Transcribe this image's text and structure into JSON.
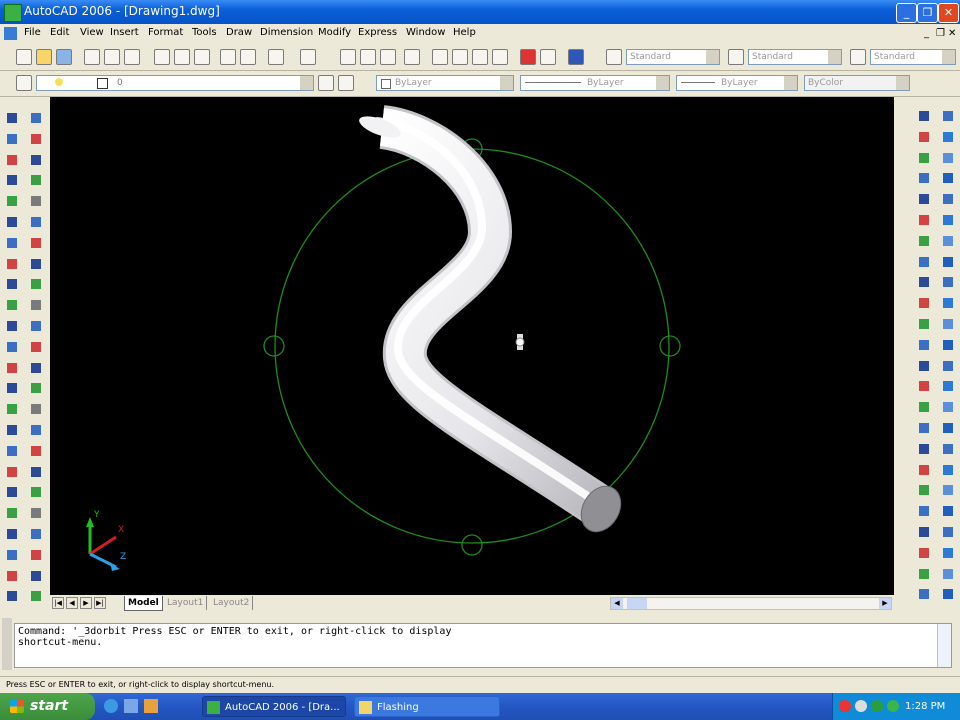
{
  "window": {
    "title": "AutoCAD 2006 - [Drawing1.dwg]"
  },
  "menu": [
    "File",
    "Edit",
    "View",
    "Insert",
    "Format",
    "Tools",
    "Draw",
    "Dimension",
    "Modify",
    "Express",
    "Window",
    "Help"
  ],
  "styles": {
    "text_style": "Standard",
    "dim_style": "Standard",
    "table_style": "Standard"
  },
  "layers": {
    "current_layer": "0",
    "color": "ByLayer",
    "linetype": "ByLayer",
    "lineweight": "ByLayer",
    "plot_style": "ByColor"
  },
  "tabs": [
    "Model",
    "Layout1",
    "Layout2"
  ],
  "active_tab": "Model",
  "command": {
    "line1": "Command:  '_3dorbit Press ESC or ENTER to exit, or right-click to display",
    "line2": "shortcut-menu."
  },
  "status": {
    "text": "Press ESC or ENTER to exit, or right-click to display shortcut-menu."
  },
  "taskbar": {
    "start": "start",
    "tasks": [
      "AutoCAD 2006 - [Dra...",
      "Flashing"
    ],
    "clock": "1:28 PM"
  },
  "ucs": {
    "x": "X",
    "y": "Y",
    "z": "Z"
  },
  "colors": {
    "canvas": "#000000",
    "orbit": "#1e8c1e",
    "solid": "#e8e8ec",
    "xp_blue": "#245edb"
  }
}
